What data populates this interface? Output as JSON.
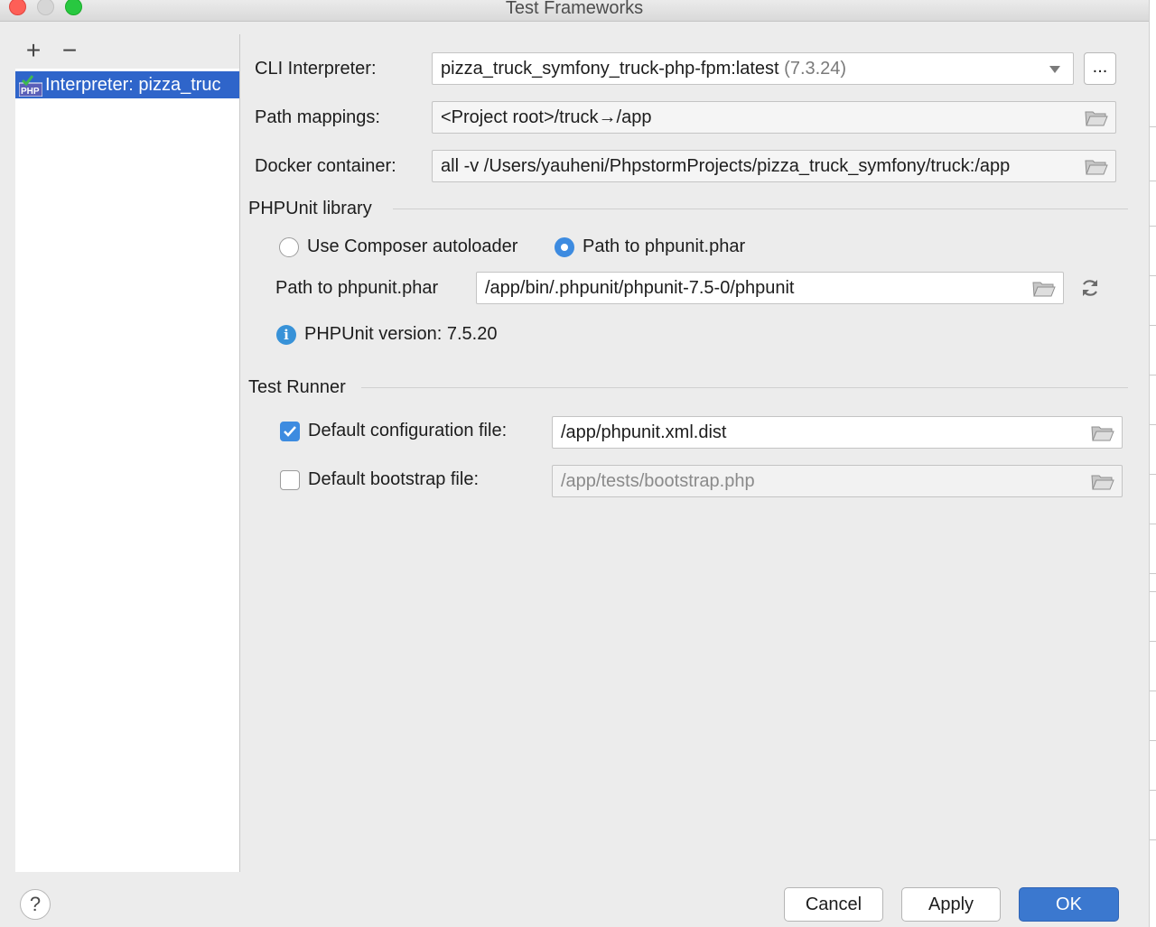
{
  "window": {
    "title": "Test Frameworks"
  },
  "toolbar": {
    "add": "+",
    "remove": "−"
  },
  "sidebar": {
    "items": [
      {
        "label": "Interpreter: pizza_truc",
        "icon": "php-icon",
        "icon_text": "PHP"
      }
    ]
  },
  "form": {
    "cli_interpreter": {
      "label": "CLI Interpreter:",
      "value": "pizza_truck_symfony_truck-php-fpm:latest",
      "version": "(7.3.24)",
      "more": "..."
    },
    "path_mappings": {
      "label": "Path mappings:",
      "value": "<Project root>/truck→/app"
    },
    "docker_container": {
      "label": "Docker container:",
      "value": "all -v /Users/yauheni/PhpstormProjects/pizza_truck_symfony/truck:/app"
    }
  },
  "phpunit": {
    "title": "PHPUnit library",
    "option_composer": "Use Composer autoloader",
    "option_phar": "Path to phpunit.phar",
    "selected": "phar",
    "path_label": "Path to phpunit.phar",
    "path_value": "/app/bin/.phpunit/phpunit-7.5-0/phpunit",
    "version_text": "PHPUnit version: 7.5.20"
  },
  "test_runner": {
    "title": "Test Runner",
    "config": {
      "label": "Default configuration file:",
      "value": "/app/phpunit.xml.dist",
      "checked": true
    },
    "bootstrap": {
      "label": "Default bootstrap file:",
      "value": "/app/tests/bootstrap.php",
      "checked": false
    }
  },
  "footer": {
    "help": "?",
    "cancel": "Cancel",
    "apply": "Apply",
    "ok": "OK"
  },
  "colors": {
    "selection": "#2f65ca",
    "accent": "#3d8be0",
    "primary_button": "#3b78cf"
  }
}
